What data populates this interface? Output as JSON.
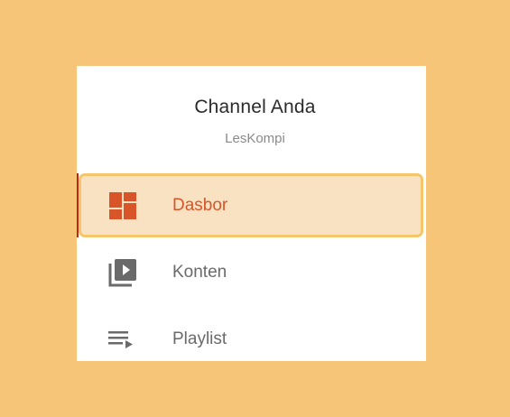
{
  "channel": {
    "title": "Channel Anda",
    "subtitle": "LesKompi"
  },
  "nav": {
    "items": [
      {
        "label": "Dasbor",
        "icon": "dashboard-icon",
        "active": true
      },
      {
        "label": "Konten",
        "icon": "video-library-icon",
        "active": false
      },
      {
        "label": "Playlist",
        "icon": "playlist-icon",
        "active": false
      }
    ]
  },
  "colors": {
    "background": "#F6C577",
    "panel": "#FFFFFF",
    "active_bg": "#F8E2C2",
    "active_border": "#F5C56A",
    "active_text": "#D8552A",
    "inactive_text": "#6A6A6A",
    "marker": "#B22C1D"
  }
}
